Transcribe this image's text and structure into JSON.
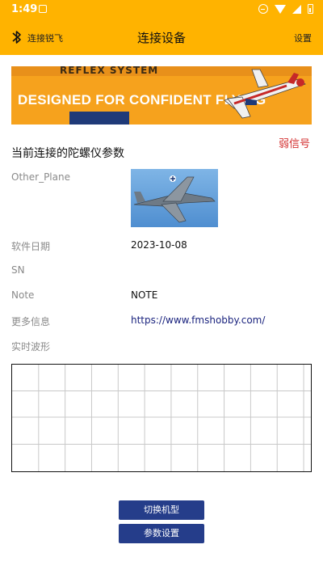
{
  "status_bar": {
    "time": "1:49"
  },
  "header": {
    "bluetooth_label": "连接锐飞",
    "title": "连接设备",
    "settings_label": "设置"
  },
  "banner": {
    "top_text": "REFLEX SYSTEM",
    "headline": "DESIGNED FOR CONFIDENT FLYING"
  },
  "signal_status": "弱信号",
  "section_title": "当前连接的陀螺仪参数",
  "params": {
    "model_name": "Other_Plane",
    "software_date_label": "软件日期",
    "software_date_value": "2023-10-08",
    "sn_label": "SN",
    "note_label": "Note",
    "note_value": "NOTE",
    "more_info_label": "更多信息",
    "more_info_link": "https://www.fmshobby.com/",
    "waveform_label": "实时波形"
  },
  "buttons": {
    "switch_model": "切换机型",
    "param_settings": "参数设置"
  },
  "colors": {
    "accent": "#ffb300",
    "button": "#253d8a",
    "warning": "#d32f2f",
    "link": "#1a237e"
  }
}
